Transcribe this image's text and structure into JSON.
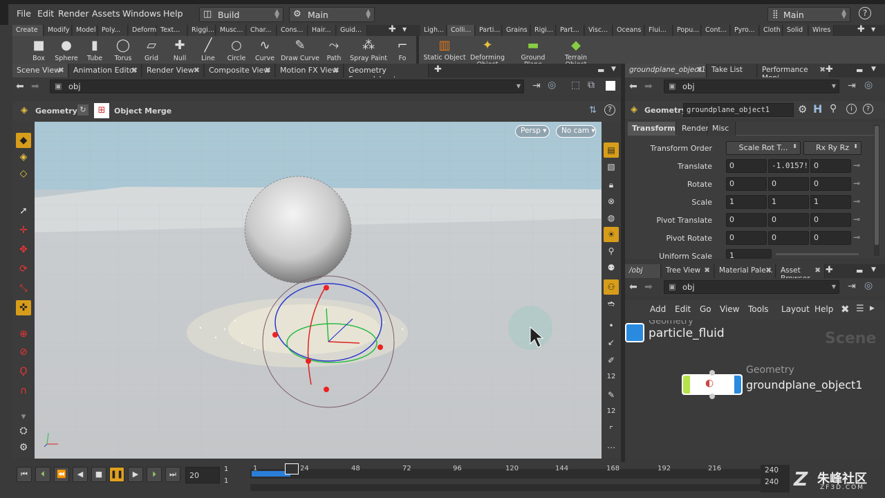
{
  "menubar": {
    "items": [
      "File",
      "Edit",
      "Render",
      "Assets",
      "Windows",
      "Help"
    ],
    "desktop": "Build",
    "context": "Main",
    "right_desktop": "Main",
    "help_icon": "?"
  },
  "shelf_tabs_left": [
    "Create",
    "Modify",
    "Model",
    "Poly...",
    "Deform",
    "Text...",
    "Riggi...",
    "Musc...",
    "Char...",
    "Cons...",
    "Hair...",
    "Guid..."
  ],
  "shelf_tabs_right": [
    "Ligh...",
    "Colli...",
    "Parti...",
    "Grains",
    "Rigi...",
    "Part...",
    "Visc...",
    "Oceans",
    "Flui...",
    "Popu...",
    "Cont...",
    "Pyro...",
    "Cloth",
    "Solid",
    "Wires"
  ],
  "tools_left": [
    {
      "label": "Box",
      "icon": "■"
    },
    {
      "label": "Sphere",
      "icon": "●"
    },
    {
      "label": "Tube",
      "icon": "▮"
    },
    {
      "label": "Torus",
      "icon": "◯"
    },
    {
      "label": "Grid",
      "icon": "▱"
    },
    {
      "label": "Null",
      "icon": "✚"
    },
    {
      "label": "Line",
      "icon": "╱"
    },
    {
      "label": "Circle",
      "icon": "○"
    },
    {
      "label": "Curve",
      "icon": "∿"
    },
    {
      "label": "Draw Curve",
      "icon": "✎"
    },
    {
      "label": "Path",
      "icon": "⤳"
    },
    {
      "label": "Spray Paint",
      "icon": "⁂"
    },
    {
      "label": "Fo",
      "icon": "⌐"
    }
  ],
  "tools_right": [
    {
      "label": "Static Object",
      "icon": "▥"
    },
    {
      "label": "Deforming Object",
      "icon": "✦"
    },
    {
      "label": "Ground Plane",
      "icon": "▬"
    },
    {
      "label": "Terrain Object",
      "icon": "◆"
    }
  ],
  "left_pane_tabs": [
    "Scene View",
    "Animation Editor",
    "Render View",
    "Composite View",
    "Motion FX View",
    "Geometry Spreadsheet"
  ],
  "left_path": "obj",
  "viewport_header": {
    "context": "Geometry",
    "tool": "Object Merge"
  },
  "viewport": {
    "camera": "Persp",
    "cam": "No cam"
  },
  "right_top_tabs": [
    "groundplane_object1",
    "Take List",
    "Performance Moni..."
  ],
  "right_path": "obj",
  "params_header": {
    "type": "Geometry",
    "name": "groundplane_object1"
  },
  "param_tabs": [
    "Transform",
    "Render",
    "Misc"
  ],
  "params": [
    {
      "label": "Transform Order",
      "values": [
        "Scale Rot T...",
        "Rx Ry Rz"
      ]
    },
    {
      "label": "Translate",
      "values": [
        "0",
        "-1.0157!",
        "0"
      ]
    },
    {
      "label": "Rotate",
      "values": [
        "0",
        "0",
        "0"
      ]
    },
    {
      "label": "Scale",
      "values": [
        "1",
        "1",
        "1"
      ]
    },
    {
      "label": "Pivot Translate",
      "values": [
        "0",
        "0",
        "0"
      ]
    },
    {
      "label": "Pivot Rotate",
      "values": [
        "0",
        "0",
        "0"
      ]
    },
    {
      "label": "Uniform Scale",
      "values": [
        "1"
      ]
    }
  ],
  "net_tabs": [
    "/obj",
    "Tree View",
    "Material Pale...",
    "Asset Browser"
  ],
  "net_path": "obj",
  "net_menu": [
    "Add",
    "Edit",
    "Go",
    "View",
    "Tools",
    "Layout",
    "Help"
  ],
  "net_watermark": "Scene",
  "nodes": [
    {
      "type": "Geometry",
      "name": "particle_fluid"
    },
    {
      "type": "Geometry",
      "name": "groundplane_object1"
    }
  ],
  "timeline": {
    "frame": "20",
    "start": "1",
    "start2": "1",
    "end": "240",
    "end2": "240",
    "ticks": [
      "1",
      "24",
      "48",
      "72",
      "96",
      "120",
      "144",
      "168",
      "192",
      "216",
      "240"
    ]
  },
  "watermark": {
    "text": "朱峰社区",
    "url": "ZF3D.COM"
  },
  "colors": {
    "accent": "#d79d1a",
    "bg": "#3a3a3a",
    "node_bar": "#b6e34a",
    "node_blue": "#2a8ae0"
  }
}
